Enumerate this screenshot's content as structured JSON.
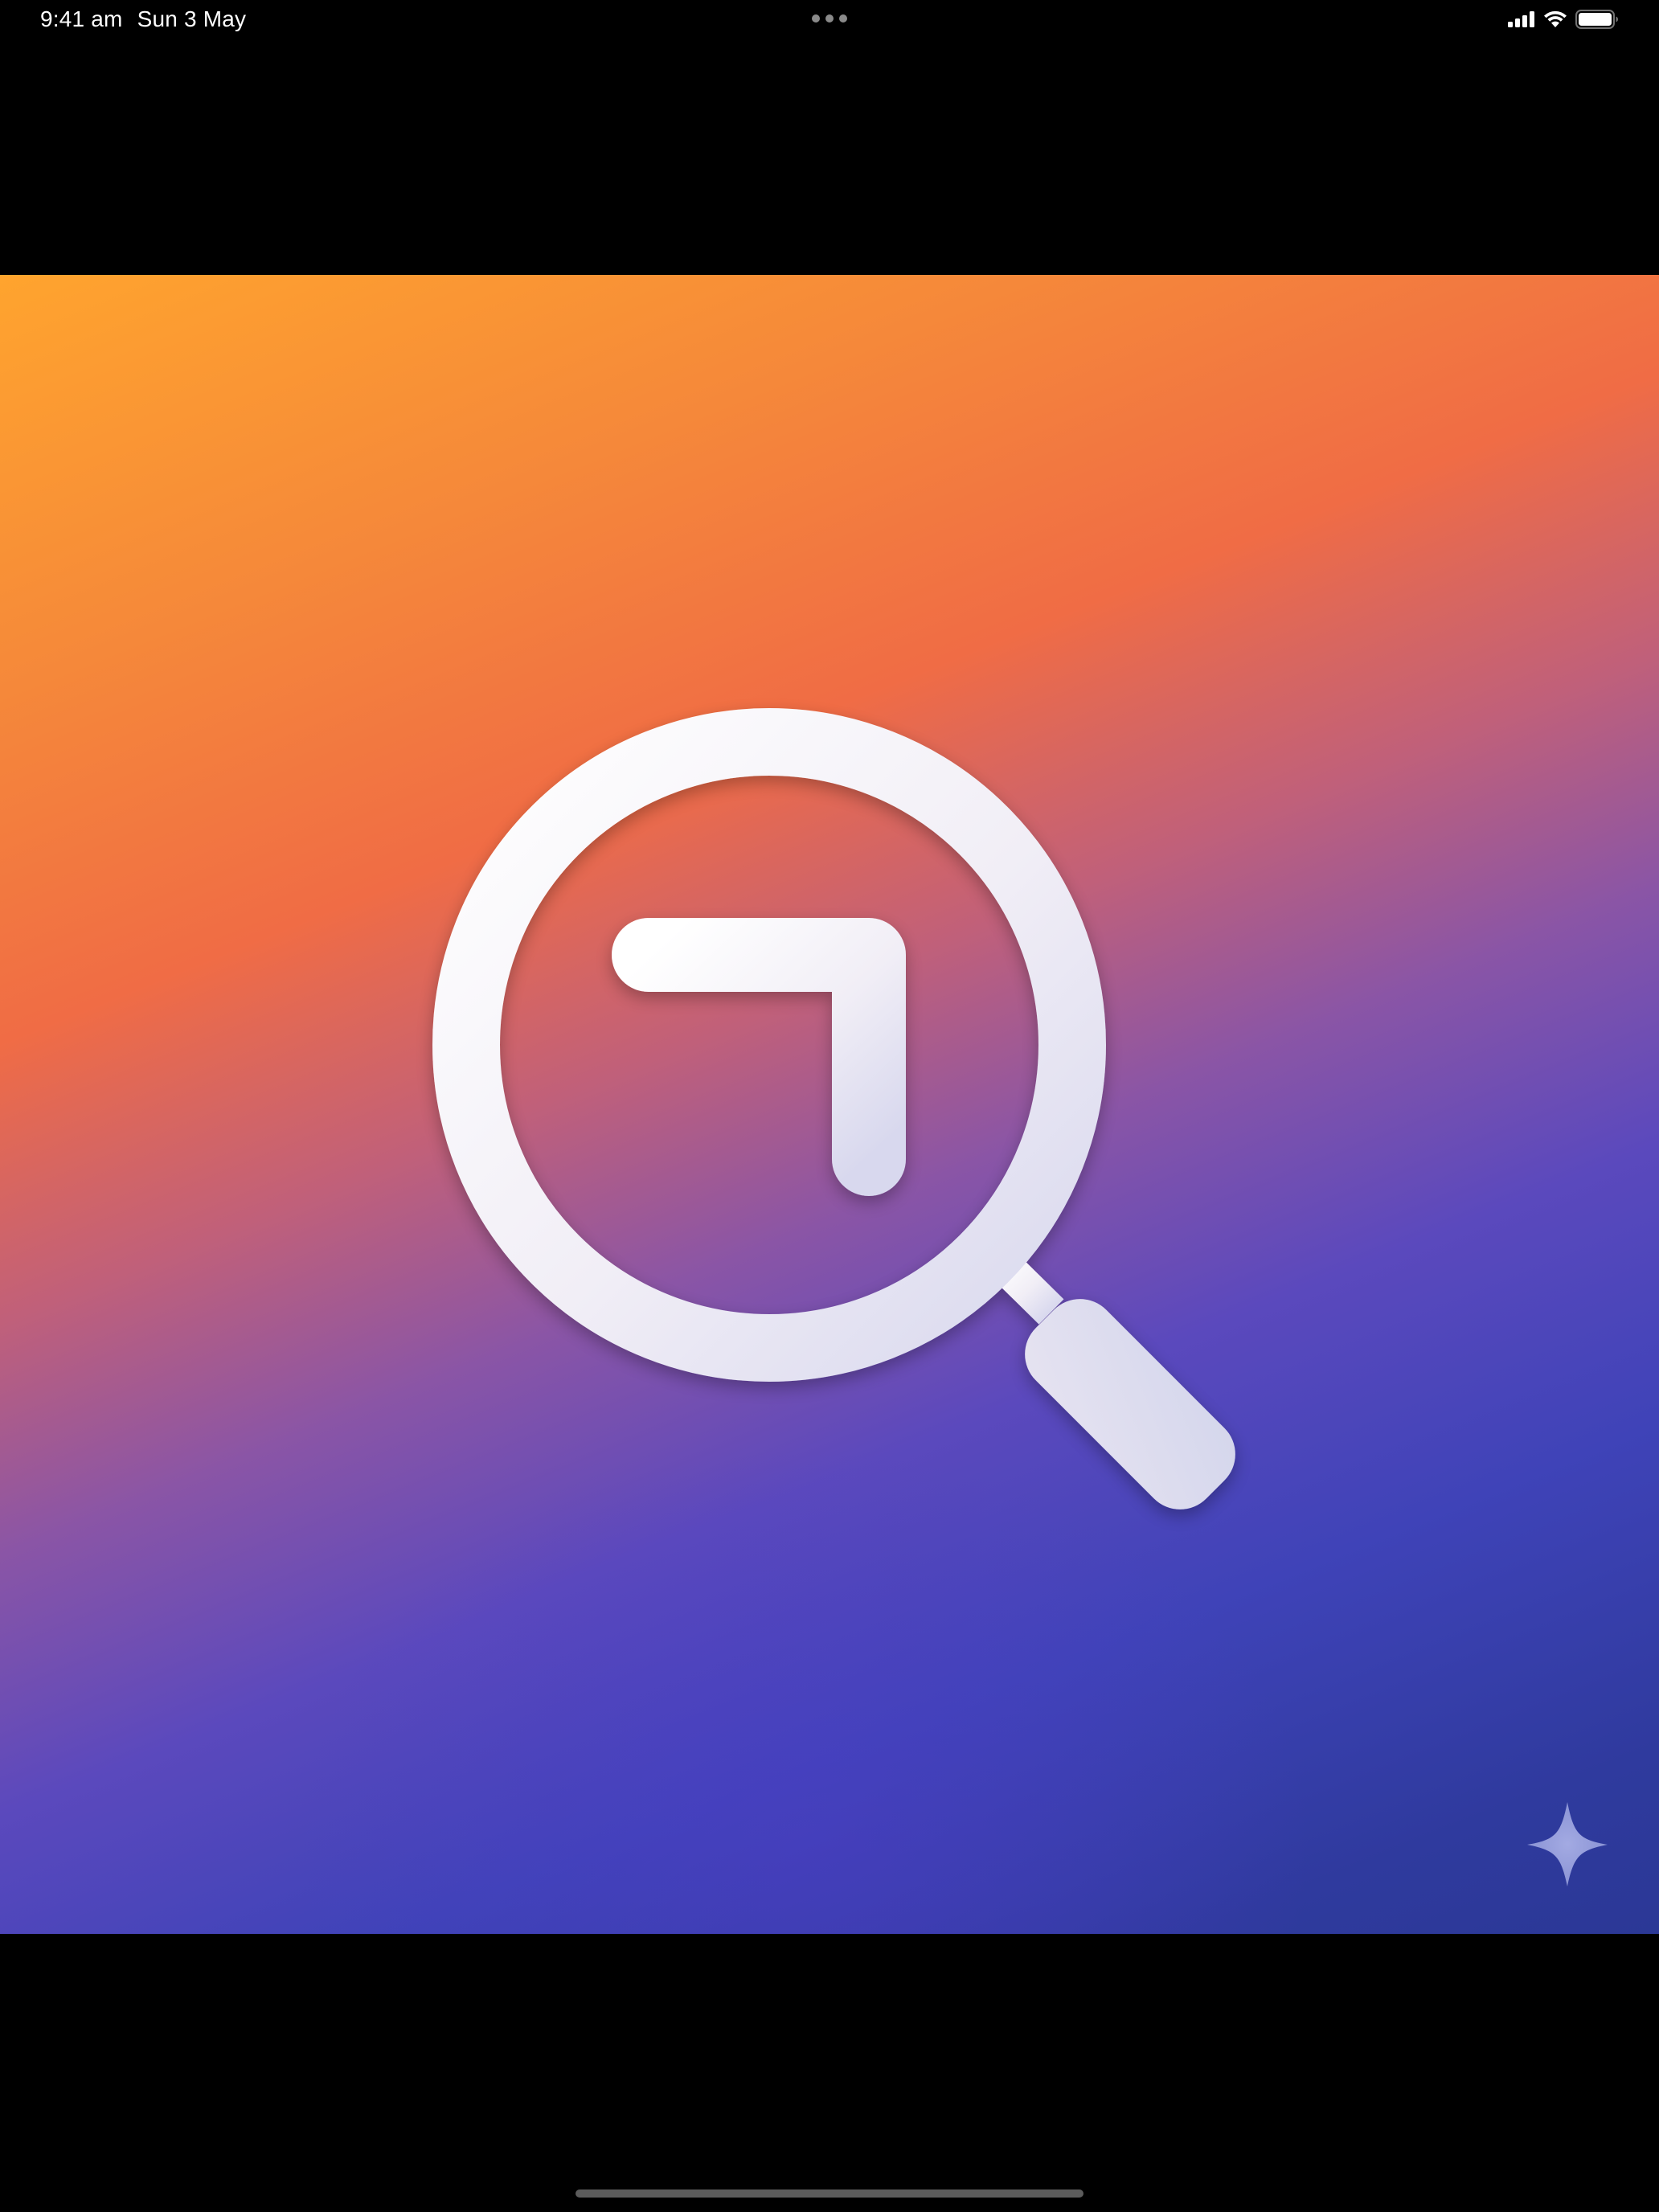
{
  "status_bar": {
    "time": "9:41 am",
    "date": "Sun 3 May",
    "multitask_icon": "ellipsis-icon",
    "signal_icon": "cellular-signal-icon",
    "wifi_icon": "wifi-icon",
    "battery_icon": "battery-icon",
    "battery_level": 1.0
  },
  "image": {
    "main_icon": "magnifying-glass-arrow-icon",
    "watermark_icon": "sparkle-icon",
    "gradient_colors": [
      "#ffa42e",
      "#f06c45",
      "#8a55a6",
      "#3f43b8",
      "#2b3896"
    ]
  },
  "home_indicator": {
    "color": "#5c5c5c"
  }
}
